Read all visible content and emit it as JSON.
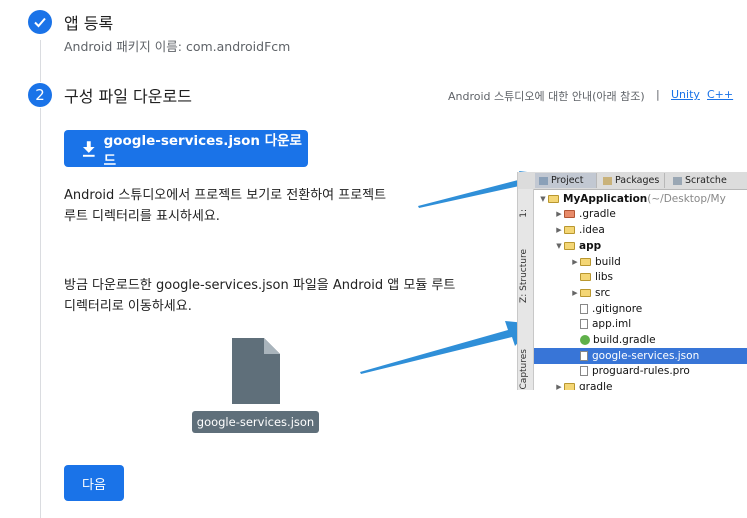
{
  "step1": {
    "number_icon": "check-icon",
    "title": "앱 등록",
    "subtitle": "Android 패키지 이름: com.androidFcm"
  },
  "step2": {
    "number": "2",
    "title": "구성 파일 다운로드",
    "guide_text": "Android 스튜디오에 대한 안내(아래 참조)",
    "separator": "|",
    "links": [
      "Unity",
      "C++"
    ],
    "download_button": "google-services.json 다운로드",
    "instruction1_line1": "Android 스튜디오에서 프로젝트 보기로 전환하여 프로젝트",
    "instruction1_line2": "루트 디렉터리를 표시하세요.",
    "instruction2_line1": "방금 다운로드한 google-services.json 파일을 Android 앱 모듈 루트",
    "instruction2_line2": "디렉터리로 이동하세요.",
    "file_label": "google-services.json",
    "next_button": "다음"
  },
  "ide": {
    "tabs": [
      "Project",
      "Packages",
      "Scratche"
    ],
    "side_labels": [
      "1:",
      "Z: Structure",
      "Captures"
    ],
    "tree": [
      {
        "indent": 0,
        "arrow": "▼",
        "icon": "folder",
        "label": "MyApplication",
        "suffix": " (~/Desktop/My",
        "bold": true
      },
      {
        "indent": 1,
        "arrow": "▶",
        "icon": "folder-red",
        "label": ".gradle"
      },
      {
        "indent": 1,
        "arrow": "▶",
        "icon": "folder",
        "label": ".idea"
      },
      {
        "indent": 1,
        "arrow": "▼",
        "icon": "folder",
        "label": "app",
        "bold": true
      },
      {
        "indent": 2,
        "arrow": "▶",
        "icon": "folder",
        "label": "build"
      },
      {
        "indent": 2,
        "arrow": "",
        "icon": "folder",
        "label": "libs"
      },
      {
        "indent": 2,
        "arrow": "▶",
        "icon": "folder",
        "label": "src"
      },
      {
        "indent": 2,
        "arrow": "",
        "icon": "file",
        "label": ".gitignore"
      },
      {
        "indent": 2,
        "arrow": "",
        "icon": "file",
        "label": "app.iml"
      },
      {
        "indent": 2,
        "arrow": "",
        "icon": "gradle",
        "label": "build.gradle"
      },
      {
        "indent": 2,
        "arrow": "",
        "icon": "file",
        "label": "google-services.json",
        "selected": true
      },
      {
        "indent": 2,
        "arrow": "",
        "icon": "file",
        "label": "proguard-rules.pro"
      },
      {
        "indent": 1,
        "arrow": "▶",
        "icon": "folder",
        "label": "gradle"
      }
    ]
  },
  "colors": {
    "accent": "#1a73e8",
    "arrow": "#2f8fd8",
    "selection": "#3875d7"
  }
}
